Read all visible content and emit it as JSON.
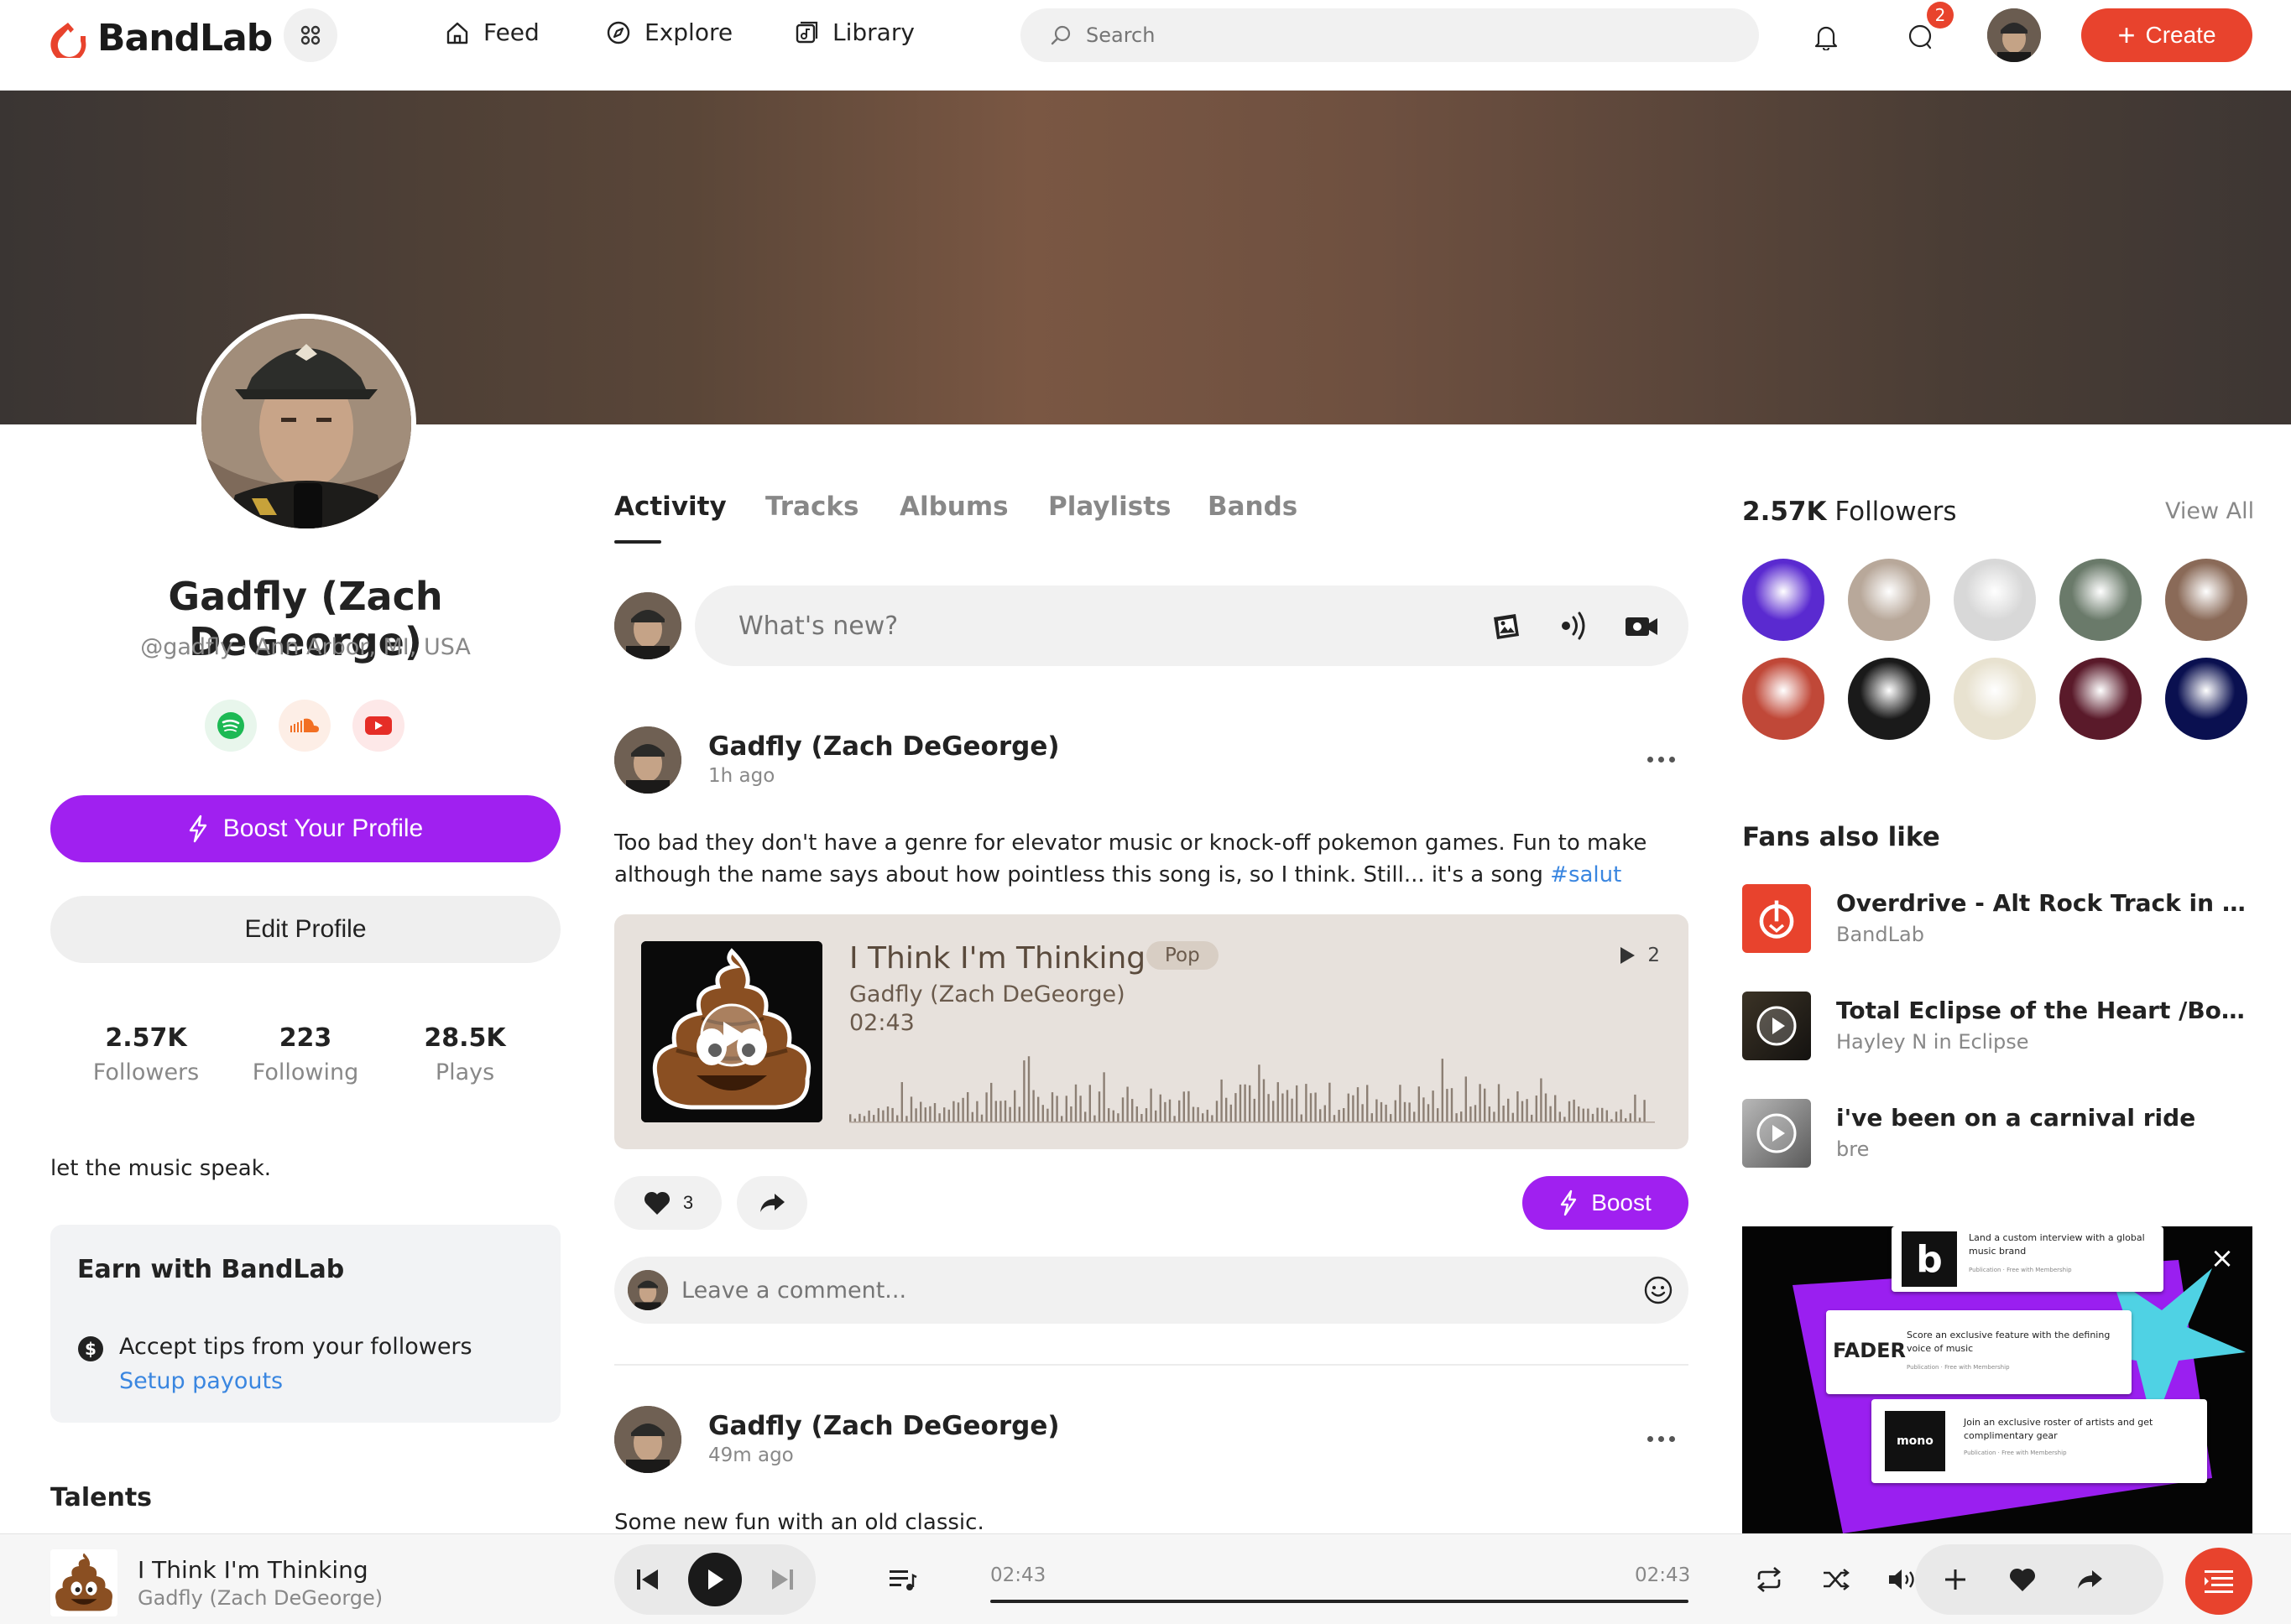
{
  "nav": {
    "logo": "BandLab",
    "links": [
      "Feed",
      "Explore",
      "Library"
    ],
    "search_placeholder": "Search",
    "message_badge": "2",
    "create_label": "Create"
  },
  "profile": {
    "name": "Gadfly (Zach DeGeorge)",
    "handle": "@gadfly · Ann Arbor, MI, USA",
    "boost_label": "Boost Your Profile",
    "edit_label": "Edit Profile",
    "stats": [
      {
        "value": "2.57K",
        "label": "Followers"
      },
      {
        "value": "223",
        "label": "Following"
      },
      {
        "value": "28.5K",
        "label": "Plays"
      }
    ],
    "bio": "let the music speak.",
    "earn": {
      "title": "Earn with BandLab",
      "text": "Accept tips from your followers",
      "link": "Setup payouts"
    },
    "talents_title": "Talents"
  },
  "tabs": [
    "Activity",
    "Tracks",
    "Albums",
    "Playlists",
    "Bands"
  ],
  "composer": {
    "placeholder": "What's new?"
  },
  "posts": [
    {
      "author": "Gadfly (Zach DeGeorge)",
      "time": "1h ago",
      "text": "Too bad they don't have a genre for elevator music or knock-off pokemon games. Fun to make although the name says about how pointless this song is, so I think. Still... it's a song",
      "hashtag": "#salut",
      "track": {
        "title": "I Think I'm Thinking",
        "genre": "Pop",
        "artist": "Gadfly (Zach DeGeorge)",
        "duration": "02:43",
        "plays": "2"
      },
      "likes": "3",
      "boost_label": "Boost",
      "comment_placeholder": "Leave a comment..."
    },
    {
      "author": "Gadfly (Zach DeGeorge)",
      "time": "49m ago",
      "text": "Some new fun with an old classic."
    }
  ],
  "followers": {
    "count": "2.57K",
    "label": "Followers",
    "view_all": "View All",
    "avatar_colors": [
      "#5a2ad0",
      "#b8a89a",
      "#d8d8d8",
      "#6a7a6a",
      "#8a6a58",
      "#c04838",
      "#1a1a1a",
      "#e8e2d0",
      "#5a1a2a",
      "#0a1050"
    ]
  },
  "fans_also_like": {
    "title": "Fans also like",
    "items": [
      {
        "title": "Overdrive - Alt Rock Track in A Mino...",
        "sub": "BandLab"
      },
      {
        "title": "Total Eclipse of the Heart /Bonnie Ty...",
        "sub": "Hayley N in Eclipse"
      },
      {
        "title": "i've been on a carnival ride",
        "sub": "bre"
      }
    ]
  },
  "ad": {
    "cards": [
      {
        "brand": "b",
        "text": "Land a custom interview with a global music brand",
        "sub": "Publication · Free with Membership"
      },
      {
        "brand": "FADER",
        "text": "Score an exclusive feature with the defining voice of music",
        "sub": "Publication · Free with Membership"
      },
      {
        "brand": "mono",
        "text": "Join an exclusive roster of artists and get complimentary gear",
        "sub": "Publication · Free with Membership"
      }
    ]
  },
  "player": {
    "title": "I Think I'm Thinking",
    "artist": "Gadfly (Zach DeGeorge)",
    "current_time": "02:43",
    "total_time": "02:43",
    "progress": 1.0
  },
  "colors": {
    "accent": "#e8432d",
    "boost": "#a020f0",
    "link": "#3a86e0"
  }
}
